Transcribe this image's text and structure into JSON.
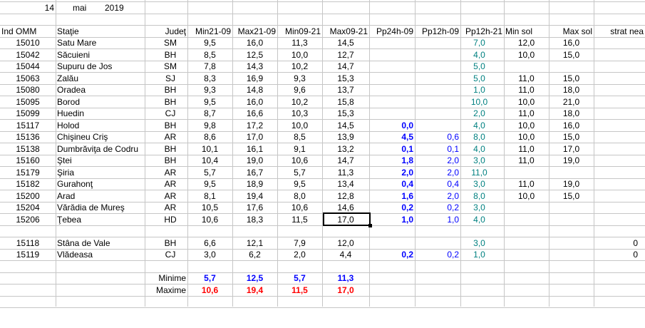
{
  "colors": {
    "blue": "#0000FF",
    "red": "#FF0000",
    "teal": "#008080",
    "grid": "#C6C6C6"
  },
  "header": {
    "day": "14",
    "month": "mai",
    "year": "2019"
  },
  "columns": [
    "Ind OMM",
    "Staţie",
    "Judeţ",
    "Min21-09",
    "Max21-09",
    "Min09-21",
    "Max09-21",
    "Pp24h-09",
    "Pp12h-09",
    "Pp12h-21",
    "Min sol",
    "Max sol",
    "strat nea"
  ],
  "rows": [
    {
      "id": "15010",
      "station": "Satu Mare",
      "county": "SM",
      "min2109": "9,5",
      "max2109": "16,0",
      "min0921": "11,3",
      "max0921": "14,5",
      "pp24": "",
      "pp12a": "",
      "pp12b": "7,0",
      "minsol": "12,0",
      "maxsol": "16,0",
      "snow": ""
    },
    {
      "id": "15042",
      "station": "Săcuieni",
      "county": "BH",
      "min2109": "8,5",
      "max2109": "12,5",
      "min0921": "10,0",
      "max0921": "12,7",
      "pp24": "",
      "pp12a": "",
      "pp12b": "4,0",
      "minsol": "10,0",
      "maxsol": "15,0",
      "snow": ""
    },
    {
      "id": "15044",
      "station": "Supuru de Jos",
      "county": "SM",
      "min2109": "7,8",
      "max2109": "14,3",
      "min0921": "10,2",
      "max0921": "14,7",
      "pp24": "",
      "pp12a": "",
      "pp12b": "5,0",
      "minsol": "",
      "maxsol": "",
      "snow": ""
    },
    {
      "id": "15063",
      "station": "Zalău",
      "county": "SJ",
      "min2109": "8,3",
      "max2109": "16,9",
      "min0921": "9,3",
      "max0921": "15,3",
      "pp24": "",
      "pp12a": "",
      "pp12b": "5,0",
      "minsol": "11,0",
      "maxsol": "15,0",
      "snow": ""
    },
    {
      "id": "15080",
      "station": "Oradea",
      "county": "BH",
      "min2109": "9,3",
      "max2109": "14,8",
      "min0921": "9,6",
      "max0921": "13,7",
      "pp24": "",
      "pp12a": "",
      "pp12b": "1,0",
      "minsol": "11,0",
      "maxsol": "18,0",
      "snow": ""
    },
    {
      "id": "15095",
      "station": "Borod",
      "county": "BH",
      "min2109": "9,5",
      "max2109": "16,0",
      "min0921": "10,2",
      "max0921": "15,8",
      "pp24": "",
      "pp12a": "",
      "pp12b": "10,0",
      "minsol": "10,0",
      "maxsol": "21,0",
      "snow": ""
    },
    {
      "id": "15099",
      "station": "Huedin",
      "county": "CJ",
      "min2109": "8,7",
      "max2109": "16,6",
      "min0921": "10,3",
      "max0921": "15,3",
      "pp24": "",
      "pp12a": "",
      "pp12b": "2,0",
      "minsol": "11,0",
      "maxsol": "18,0",
      "snow": ""
    },
    {
      "id": "15117",
      "station": "Holod",
      "county": "BH",
      "min2109": "9,8",
      "max2109": "17,2",
      "min0921": "10,0",
      "max0921": "14,5",
      "pp24": "0,0",
      "pp12a": "",
      "pp12b": "4,0",
      "minsol": "10,0",
      "maxsol": "16,0",
      "snow": ""
    },
    {
      "id": "15136",
      "station": "Chişineu     Criş",
      "county": "AR",
      "min2109": "8,6",
      "max2109": "17,0",
      "min0921": "8,5",
      "max0921": "13,9",
      "pp24": "4,5",
      "pp12a": "0,6",
      "pp12b": "8,0",
      "minsol": "10,0",
      "maxsol": "15,0",
      "snow": ""
    },
    {
      "id": "15138",
      "station": "Dumbrăviţa  de Codru",
      "county": "BH",
      "min2109": "10,1",
      "max2109": "16,1",
      "min0921": "9,1",
      "max0921": "13,2",
      "pp24": "0,1",
      "pp12a": "0,1",
      "pp12b": "4,0",
      "minsol": "11,0",
      "maxsol": "17,0",
      "snow": ""
    },
    {
      "id": "15160",
      "station": "Ştei",
      "county": "BH",
      "min2109": "10,4",
      "max2109": "19,0",
      "min0921": "10,6",
      "max0921": "14,7",
      "pp24": "1,8",
      "pp12a": "2,0",
      "pp12b": "3,0",
      "minsol": "11,0",
      "maxsol": "19,0",
      "snow": ""
    },
    {
      "id": "15179",
      "station": "Şiria",
      "county": "AR",
      "min2109": "5,7",
      "max2109": "16,7",
      "min0921": "5,7",
      "max0921": "11,3",
      "pp24": "2,0",
      "pp12a": "2,0",
      "pp12b": "11,0",
      "minsol": "",
      "maxsol": "",
      "snow": ""
    },
    {
      "id": "15182",
      "station": "Gurahonţ",
      "county": "AR",
      "min2109": "9,5",
      "max2109": "18,9",
      "min0921": "9,5",
      "max0921": "13,4",
      "pp24": "0,4",
      "pp12a": "0,4",
      "pp12b": "3,0",
      "minsol": "11,0",
      "maxsol": "19,0",
      "snow": ""
    },
    {
      "id": "15200",
      "station": "Arad",
      "county": "AR",
      "min2109": "8,1",
      "max2109": "19,4",
      "min0921": "8,0",
      "max0921": "12,8",
      "pp24": "1,6",
      "pp12a": "2,0",
      "pp12b": "8,0",
      "minsol": "10,0",
      "maxsol": "15,0",
      "snow": ""
    },
    {
      "id": "15204",
      "station": "Vărădia de Mureş",
      "county": "AR",
      "min2109": "10,5",
      "max2109": "17,6",
      "min0921": "10,6",
      "max0921": "14,6",
      "pp24": "0,2",
      "pp12a": "0,2",
      "pp12b": "3,0",
      "minsol": "",
      "maxsol": "",
      "snow": ""
    },
    {
      "id": "15206",
      "station": "Ţebea",
      "county": "HD",
      "min2109": "10,6",
      "max2109": "18,3",
      "min0921": "11,5",
      "max0921": "17,0",
      "pp24": "1,0",
      "pp12a": "1,0",
      "pp12b": "4,0",
      "minsol": "",
      "maxsol": "",
      "snow": ""
    },
    {
      "id": "15118",
      "station": "Stâna de Vale",
      "county": "BH",
      "min2109": "6,6",
      "max2109": "12,1",
      "min0921": "7,9",
      "max0921": "12,0",
      "pp24": "",
      "pp12a": "",
      "pp12b": "3,0",
      "minsol": "",
      "maxsol": "",
      "snow": "0"
    },
    {
      "id": "15119",
      "station": "Vlădeasa",
      "county": "CJ",
      "min2109": "3,0",
      "max2109": "6,2",
      "min0921": "2,0",
      "max0921": "4,4",
      "pp24": "0,2",
      "pp12a": "0,2",
      "pp12b": "1,0",
      "minsol": "",
      "maxsol": "",
      "snow": "0"
    }
  ],
  "summary": {
    "min_label": "Minime",
    "max_label": "Maxime",
    "min_values": [
      "5,7",
      "12,5",
      "5,7",
      "11,3"
    ],
    "max_values": [
      "10,6",
      "19,4",
      "11,5",
      "17,0"
    ]
  },
  "selected_cell": "Max09-21 · Ţebea"
}
